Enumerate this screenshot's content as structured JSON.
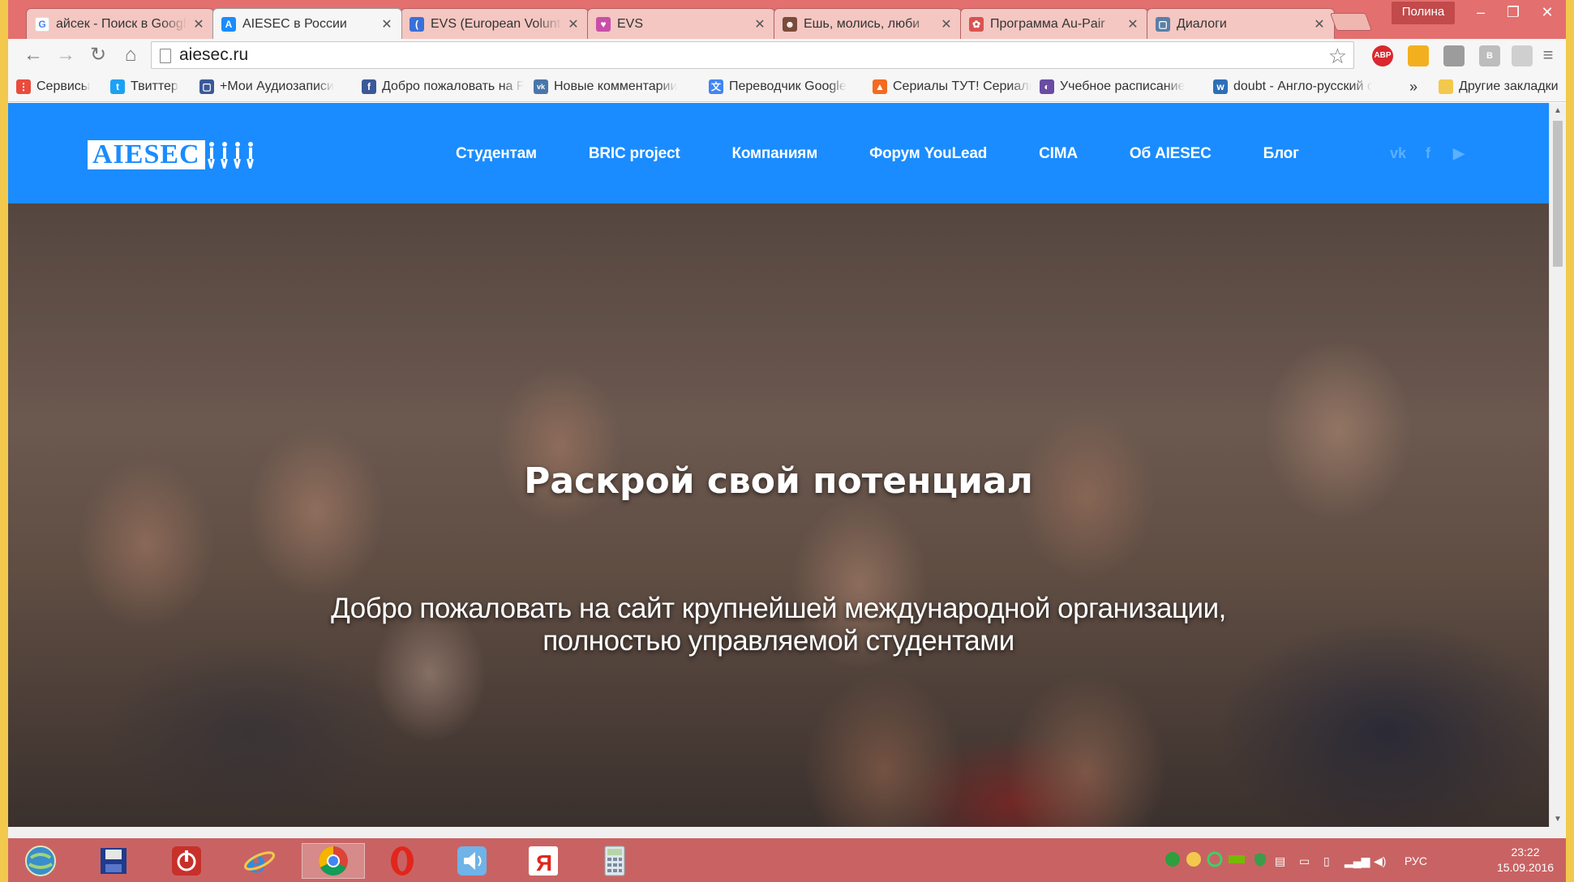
{
  "browser": {
    "tabs": [
      {
        "title": "айсек - Поиск в Google",
        "icon_color": "#ffffff",
        "icon_letter": "G",
        "active": false
      },
      {
        "title": "AIESEC в России",
        "icon_color": "#1a8cff",
        "icon_letter": "A",
        "active": true
      },
      {
        "title": "EVS (European Volunteer Service)",
        "icon_color": "#3a6fd8",
        "icon_letter": "(",
        "active": false
      },
      {
        "title": "EVS",
        "icon_color": "#c84fa8",
        "icon_letter": "♥",
        "active": false
      },
      {
        "title": "Ешь, молись, люби",
        "icon_color": "#7a4b3a",
        "icon_letter": "☻",
        "active": false
      },
      {
        "title": "Программа Au-Pair",
        "icon_color": "#d9534f",
        "icon_letter": "✿",
        "active": false
      },
      {
        "title": "Диалоги",
        "icon_color": "#5b7fa6",
        "icon_letter": "▢",
        "active": false
      }
    ],
    "profile_name": "Полина",
    "window_controls": {
      "minimize": "–",
      "restore": "❐",
      "close": "✕"
    },
    "url": "aiesec.ru",
    "extensions": [
      {
        "name": "adblock-plus-icon",
        "label": "ABP",
        "color": "#d9282f"
      },
      {
        "name": "bookmark-flag-icon",
        "label": "",
        "color": "#f2b01e"
      },
      {
        "name": "screen-extension-icon",
        "label": "",
        "color": "#9c9c9c"
      },
      {
        "name": "b-extension-icon",
        "label": "B",
        "color": "#bdbdbd"
      },
      {
        "name": "grey-extension-icon",
        "label": "",
        "color": "#cfcfcf"
      }
    ]
  },
  "bookmarks": {
    "items": [
      {
        "label": "Сервисы",
        "icon_color": "#e84c3d",
        "icon": "⋮"
      },
      {
        "label": "Твиттер",
        "icon_color": "#1da1f2",
        "icon": "t"
      },
      {
        "label": "+Мои Аудиозаписи",
        "icon_color": "#3b5998",
        "icon": "▢"
      },
      {
        "label": "Добро пожаловать на Facebook",
        "icon_color": "#3b5998",
        "icon": "f"
      },
      {
        "label": "Новые комментарии",
        "icon_color": "#4a76a8",
        "icon": "vk"
      },
      {
        "label": "Переводчик Google",
        "icon_color": "#4285f4",
        "icon": "文"
      },
      {
        "label": "Сериалы ТУТ! Сериалы онлайн",
        "icon_color": "#f36b21",
        "icon": "▲"
      },
      {
        "label": "Учебное расписание",
        "icon_color": "#6a4ca3",
        "icon": "◐"
      },
      {
        "label": "doubt - Англо-русский словарь",
        "icon_color": "#2d6fb7",
        "icon": "w"
      }
    ],
    "more": "»",
    "other": "Другие закладки"
  },
  "site": {
    "logo_text": "AIESEC",
    "nav": [
      "Студентам",
      "BRIC project",
      "Компаниям",
      "Форум YouLead",
      "CIMA",
      "Об AIESEC",
      "Блог"
    ],
    "social": [
      "vk",
      "f",
      "▶"
    ],
    "hero": {
      "title": "Раскрой свой потенциал",
      "subtitle_line1": "Добро пожаловать на сайт крупнейшей международной организации,",
      "subtitle_line2": "полностью управляемой студентами"
    }
  },
  "taskbar": {
    "language": "РУС",
    "time": "23:22",
    "date": "15.09.2016"
  },
  "colors": {
    "accent": "#1a8cff",
    "tabstrip": "#e36f6f",
    "taskbar": "#c96363"
  }
}
